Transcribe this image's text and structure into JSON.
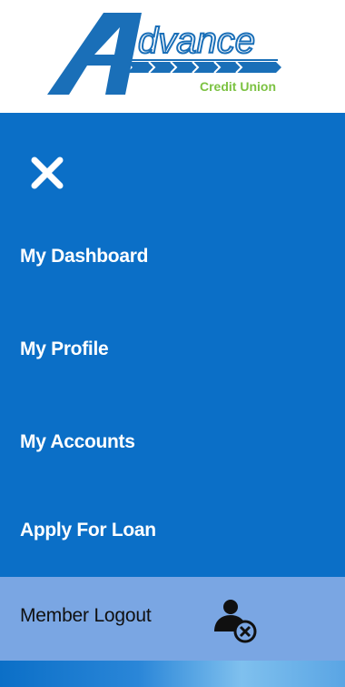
{
  "logo": {
    "brand_name": "dvance",
    "brand_initial": "A",
    "tagline": "Credit Union"
  },
  "menu": {
    "close_icon": "close-icon",
    "items": [
      {
        "label": "My Dashboard"
      },
      {
        "label": "My Profile"
      },
      {
        "label": "My Accounts"
      },
      {
        "label": "Apply For Loan"
      }
    ],
    "logout": {
      "label": "Member Logout",
      "icon": "user-remove-icon"
    }
  },
  "colors": {
    "nav_background": "#0b6fc7",
    "logout_background": "#7aa6e3",
    "logo_blue": "#1a6fb8",
    "logo_green": "#7cc242",
    "text_light": "#ffffff",
    "text_dark": "#101010"
  }
}
